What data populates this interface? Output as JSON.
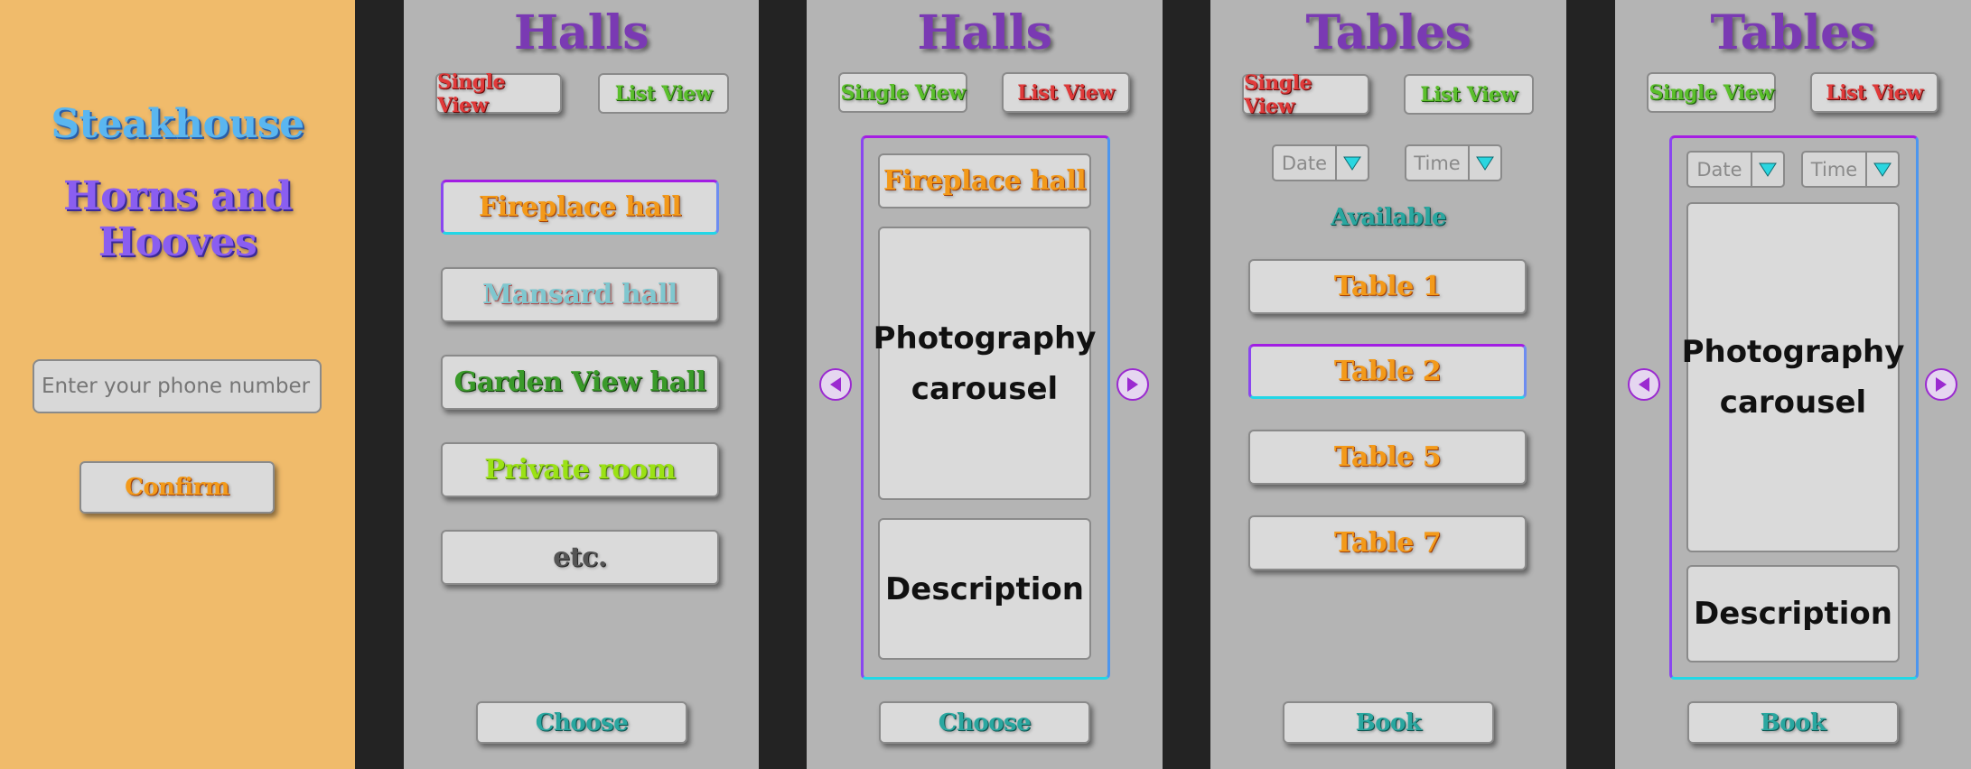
{
  "login": {
    "restaurant_line1": "Steakhouse",
    "restaurant_line2": "Horns and Hooves",
    "phone_placeholder": "Enter your phone number",
    "confirm_label": "Confirm"
  },
  "halls_list": {
    "title": "Halls",
    "single_view_label": "Single View",
    "list_view_label": "List View",
    "items": [
      "Fireplace hall",
      "Mansard hall",
      "Garden View hall",
      "Private room",
      "etc."
    ],
    "choose_label": "Choose"
  },
  "halls_single": {
    "title": "Halls",
    "single_view_label": "Single View",
    "list_view_label": "List View",
    "hall_name": "Fireplace hall",
    "carousel_line1": "Photography",
    "carousel_line2": "carousel",
    "description": "Description",
    "choose_label": "Choose"
  },
  "tables_list": {
    "title": "Tables",
    "single_view_label": "Single View",
    "list_view_label": "List View",
    "date_label": "Date",
    "time_label": "Time",
    "available_label": "Available",
    "items": [
      "Table 1",
      "Table 2",
      "Table 5",
      "Table 7"
    ],
    "book_label": "Book"
  },
  "tables_single": {
    "title": "Tables",
    "single_view_label": "Single View",
    "list_view_label": "List View",
    "date_label": "Date",
    "time_label": "Time",
    "carousel_line1": "Photography",
    "carousel_line2": "carousel",
    "description": "Description",
    "book_label": "Book"
  },
  "colors": {
    "login_bg": "#f0bb6b",
    "panel_bg": "#b4b4b4",
    "gap_bg": "#232323",
    "title_purple": "#7a3ab3"
  },
  "icons": [
    "chevron-left-icon",
    "chevron-right-icon",
    "dropdown-arrow-icon"
  ]
}
